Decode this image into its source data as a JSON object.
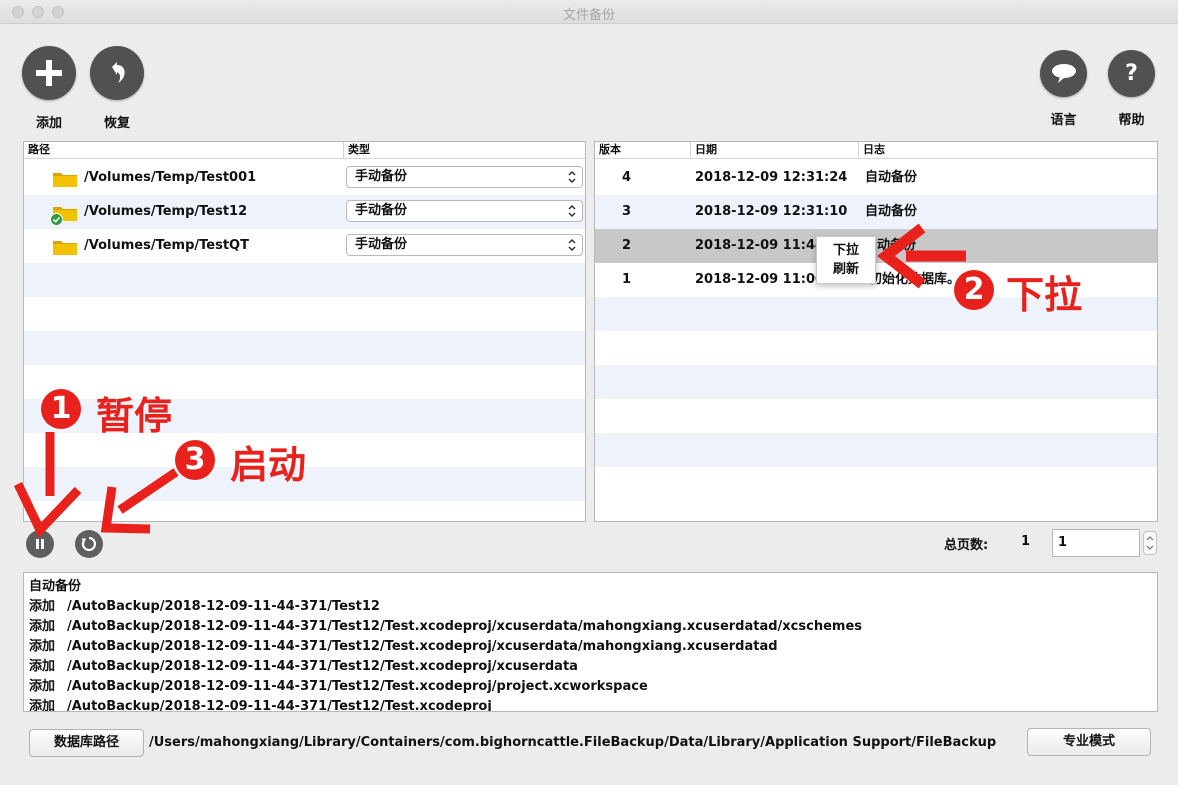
{
  "window": {
    "title": "文件备份"
  },
  "toolbar": {
    "add_label": "添加",
    "restore_label": "恢复",
    "language_label": "语言",
    "help_label": "帮助"
  },
  "left_table": {
    "headers": [
      "路径",
      "类型"
    ],
    "rows": [
      {
        "path": "/Volumes/Temp/Test001",
        "type": "手动备份",
        "status": ""
      },
      {
        "path": "/Volumes/Temp/Test12",
        "type": "手动备份",
        "status": "checked"
      },
      {
        "path": "/Volumes/Temp/TestQT",
        "type": "手动备份",
        "status": ""
      }
    ]
  },
  "right_table": {
    "headers": [
      "版本",
      "日期",
      "日志"
    ],
    "rows": [
      {
        "version": "4",
        "date": "2018-12-09 12:31:24",
        "log": "自动备份"
      },
      {
        "version": "3",
        "date": "2018-12-09 12:31:10",
        "log": "自动备份"
      },
      {
        "version": "2",
        "date": "2018-12-09 11:44:",
        "log": "动备份"
      },
      {
        "version": "1",
        "date": "2018-12-09 11:00:",
        "log": "初始化数据库。"
      }
    ]
  },
  "context_menu": {
    "line1": "下拉",
    "line2": "刷新"
  },
  "pagination": {
    "label": "总页数:",
    "total": "1",
    "current": "1"
  },
  "log": {
    "title": "自动备份",
    "lines": [
      {
        "op": "添加",
        "path": "/AutoBackup/2018-12-09-11-44-371/Test12"
      },
      {
        "op": "添加",
        "path": "/AutoBackup/2018-12-09-11-44-371/Test12/Test.xcodeproj/xcuserdata/mahongxiang.xcuserdatad/xcschemes"
      },
      {
        "op": "添加",
        "path": "/AutoBackup/2018-12-09-11-44-371/Test12/Test.xcodeproj/xcuserdata/mahongxiang.xcuserdatad"
      },
      {
        "op": "添加",
        "path": "/AutoBackup/2018-12-09-11-44-371/Test12/Test.xcodeproj/xcuserdata"
      },
      {
        "op": "添加",
        "path": "/AutoBackup/2018-12-09-11-44-371/Test12/Test.xcodeproj/project.xcworkspace"
      },
      {
        "op": "添加",
        "path": "/AutoBackup/2018-12-09-11-44-371/Test12/Test.xcodeproj"
      }
    ]
  },
  "footer": {
    "db_button": "数据库路径",
    "db_path": "/Users/mahongxiang/Library/Containers/com.bighorncattle.FileBackup/Data/Library/Application Support/FileBackup",
    "pro_button": "专业模式"
  },
  "annotations": {
    "pause": {
      "num": "1",
      "text": "暂停"
    },
    "pull": {
      "num": "2",
      "text": "下拉"
    },
    "start": {
      "num": "3",
      "text": "启动"
    }
  },
  "colors": {
    "annotation": "#e8211c",
    "folder": "#f2c200",
    "check": "#2e9e3a",
    "alt_row": "#edf2fb",
    "selected_row": "#c8c8c8"
  }
}
